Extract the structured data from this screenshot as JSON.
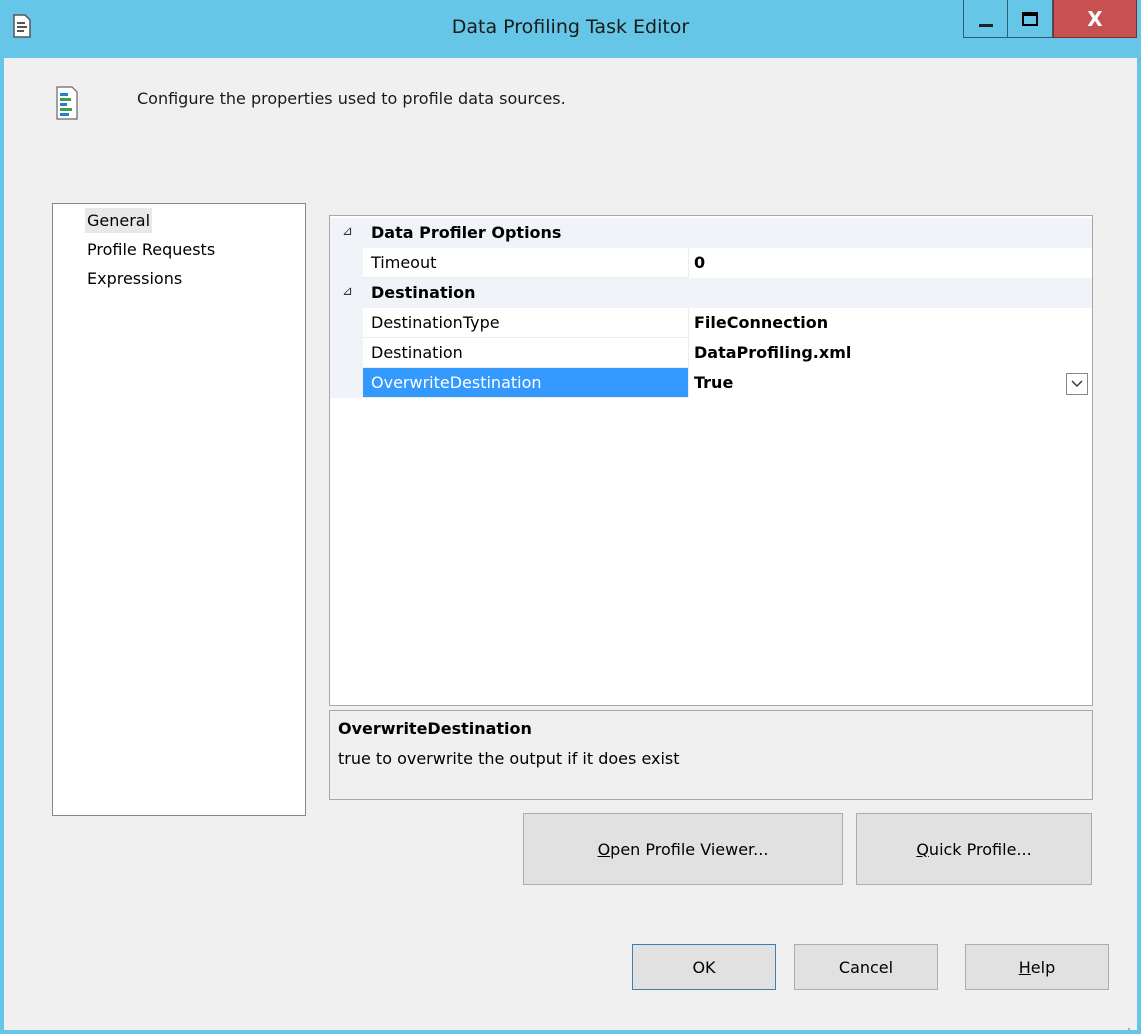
{
  "window": {
    "title": "Data Profiling Task Editor",
    "close_glyph": "X",
    "accent_color": "#66c6e8"
  },
  "header": {
    "description": "Configure the properties used to profile data sources."
  },
  "nav": {
    "items": [
      {
        "label": "General",
        "selected": true
      },
      {
        "label": "Profile Requests",
        "selected": false
      },
      {
        "label": "Expressions",
        "selected": false
      }
    ]
  },
  "property_grid": {
    "categories": [
      {
        "name": "Data Profiler Options",
        "toggle": "⊿",
        "properties": [
          {
            "name": "Timeout",
            "value": "0"
          }
        ]
      },
      {
        "name": "Destination",
        "toggle": "⊿",
        "properties": [
          {
            "name": "DestinationType",
            "value": "FileConnection"
          },
          {
            "name": "Destination",
            "value": "DataProfiling.xml"
          },
          {
            "name": "OverwriteDestination",
            "value": "True",
            "selected": true
          }
        ]
      }
    ],
    "selection_color": "#3399ff"
  },
  "description": {
    "title": "OverwriteDestination",
    "text": "true to overwrite the output if it does exist"
  },
  "buttons": {
    "open_profile_viewer": {
      "accel": "O",
      "rest": "pen Profile Viewer..."
    },
    "quick_profile": {
      "accel": "Q",
      "rest": "uick Profile..."
    },
    "ok": "OK",
    "cancel": "Cancel",
    "help": {
      "accel": "H",
      "rest": "elp"
    }
  }
}
